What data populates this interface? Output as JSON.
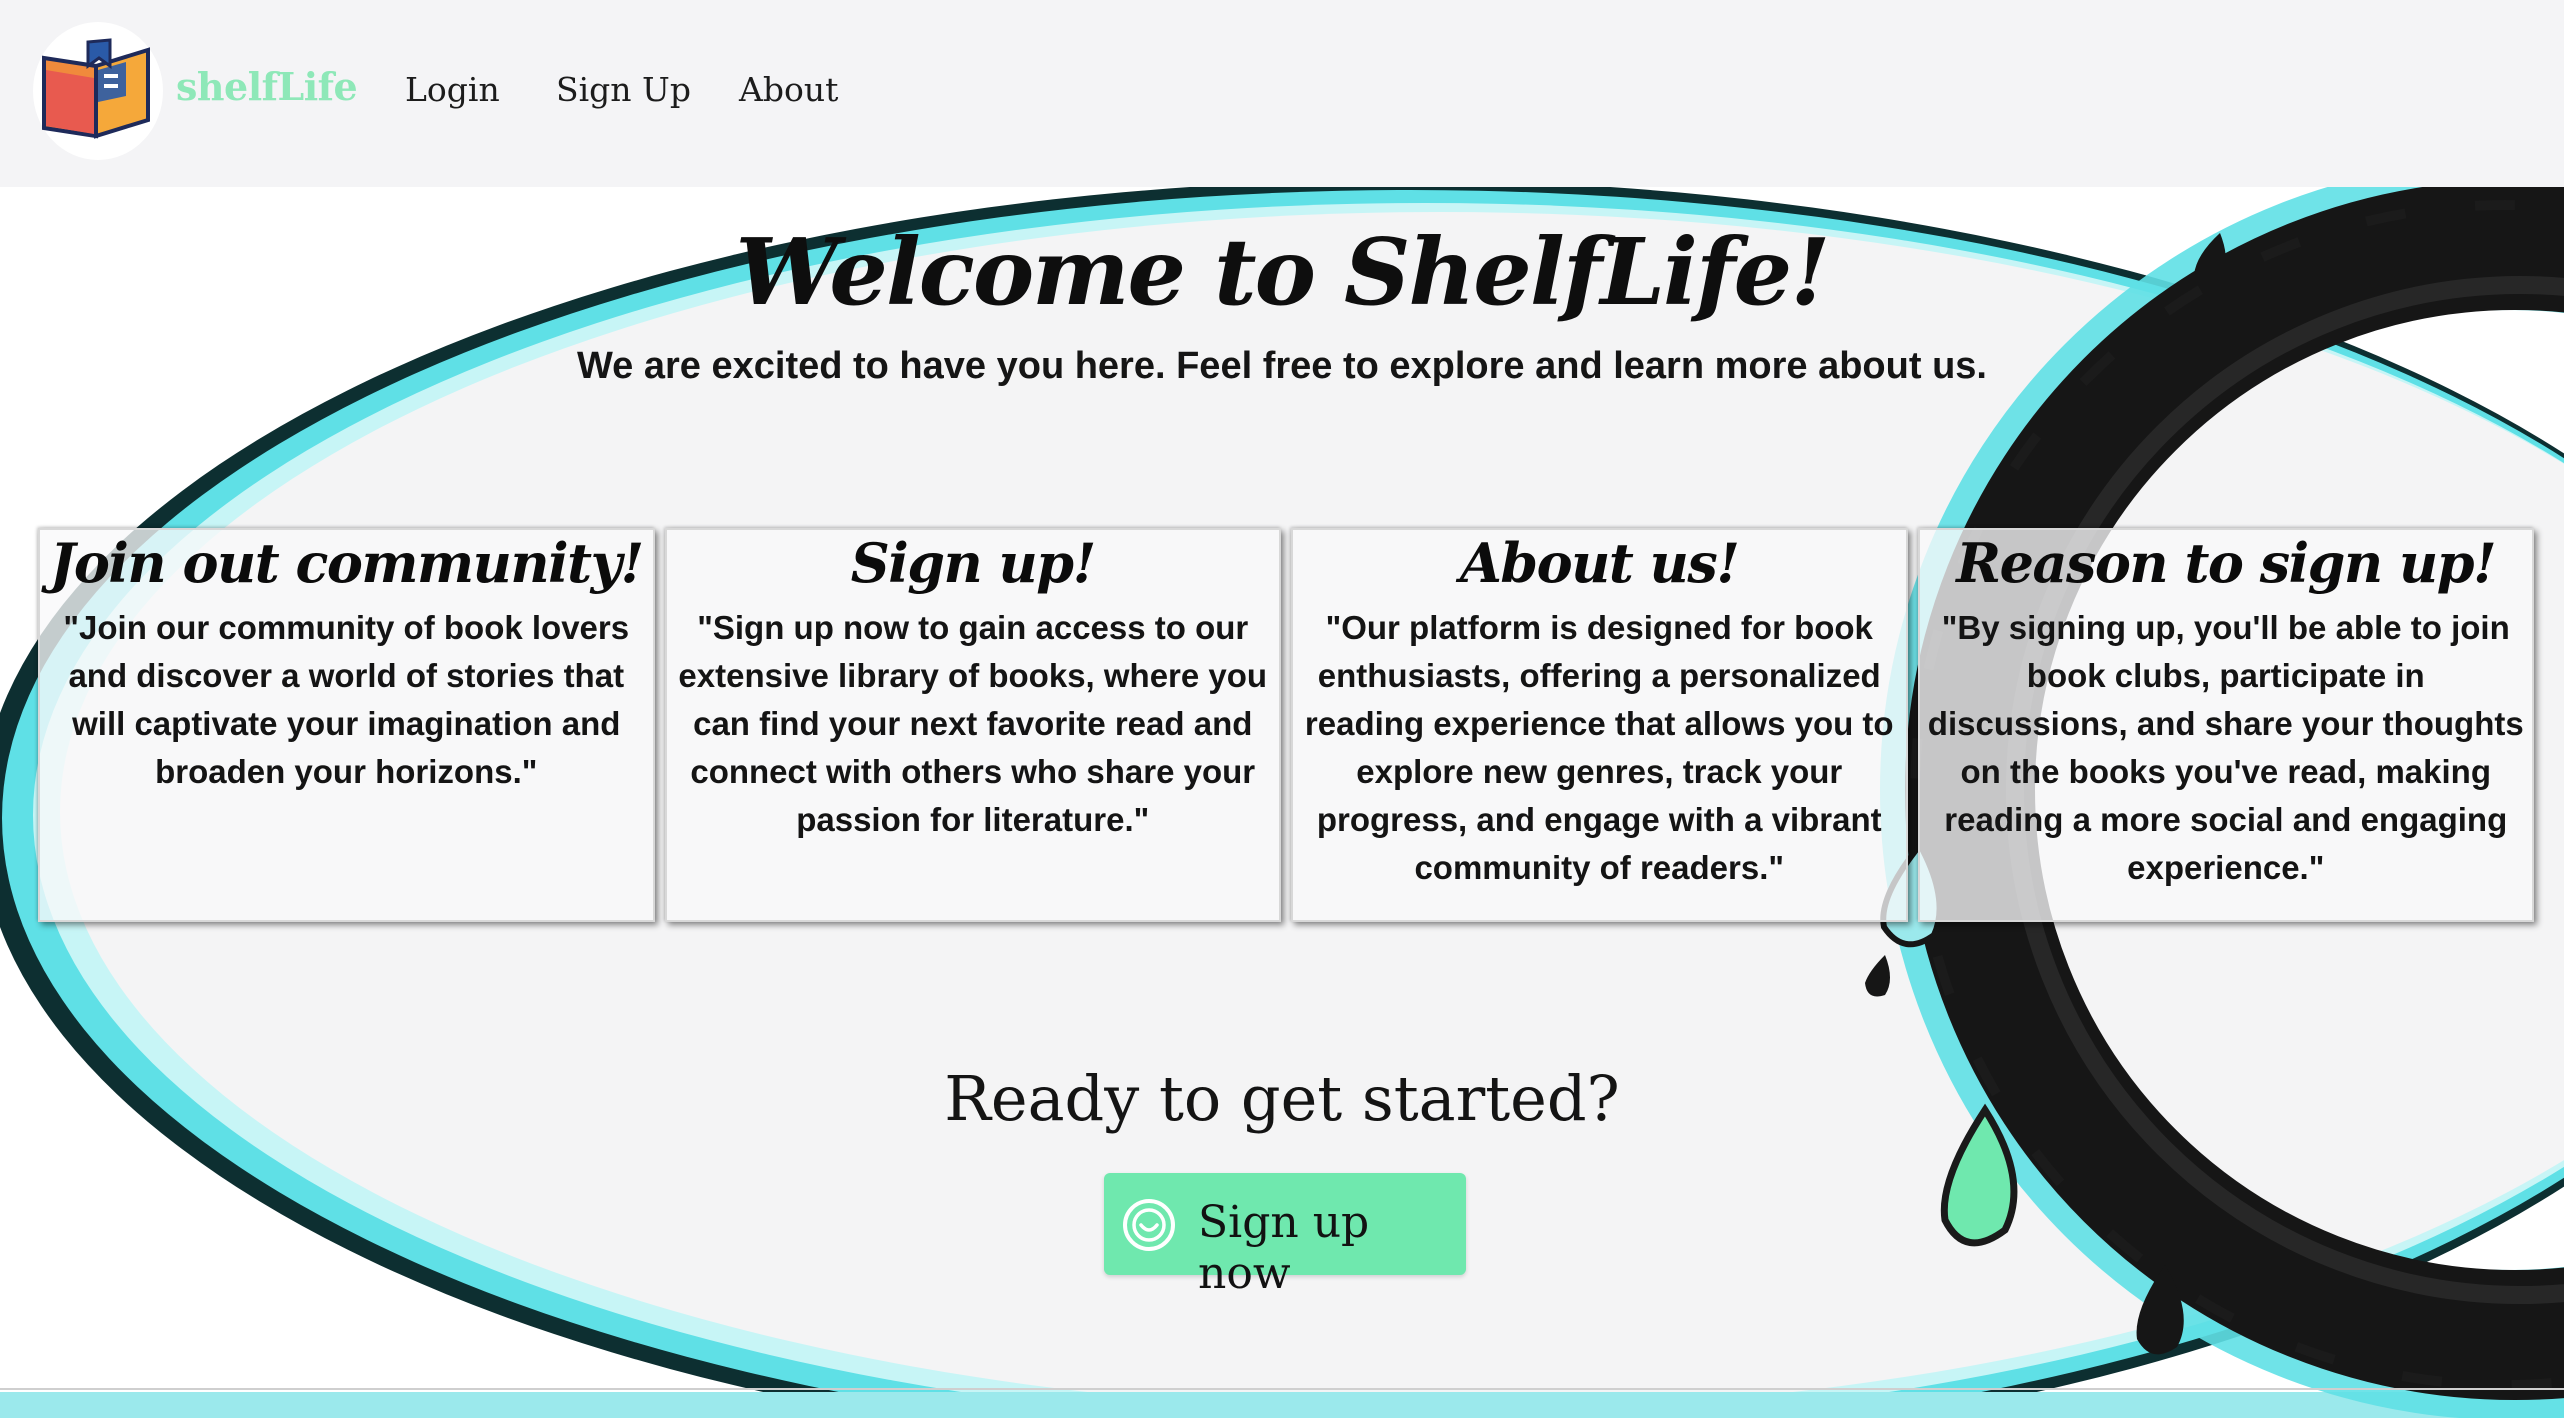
{
  "navbar": {
    "brand": "shelfLife",
    "links": [
      "Login",
      "Sign Up",
      "About"
    ]
  },
  "hero": {
    "title": "Welcome to ShelfLife!",
    "subtitle": "We are excited to have you here. Feel free to explore and learn more about us."
  },
  "cards": [
    {
      "title": "Join out community!",
      "text": "\"Join our community of book lovers and discover a world of stories that will captivate your imagination and broaden your horizons.\""
    },
    {
      "title": "Sign up!",
      "text": "\"Sign up now to gain access to our extensive library of books, where you can find your next favorite read and connect with others who share your passion for literature.\""
    },
    {
      "title": "About us!",
      "text": "\"Our platform is designed for book enthusiasts, offering a personalized reading experience that allows you to explore new genres, track your progress, and engage with a vibrant community of readers.\""
    },
    {
      "title": "Reason to sign up!",
      "text": "\"By signing up, you'll be able to join book clubs, participate in discussions, and share your thoughts on the books you've read, making reading a more social and engaging experience.\""
    }
  ],
  "cta": {
    "heading": "Ready to get started?",
    "button_label": "Sign up now",
    "button_icon": "spiral-smile-icon"
  },
  "colors": {
    "brand_green": "#8ee8b8",
    "button_green": "#6fe8ae",
    "accent_cyan": "#5fe0e6",
    "ink_black": "#1c1c1c"
  }
}
